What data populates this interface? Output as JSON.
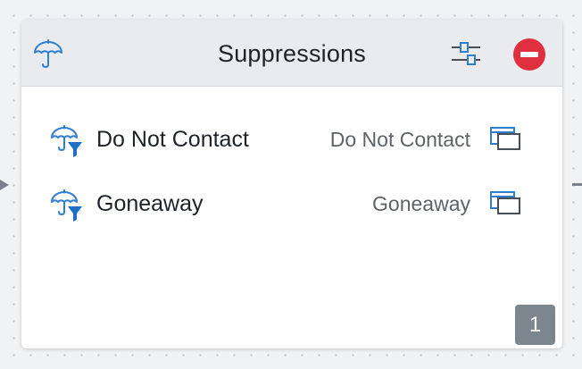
{
  "card": {
    "title": "Suppressions",
    "header_icon": "umbrella-icon",
    "actions": {
      "settings_icon": "sliders-icon",
      "remove_icon": "minus-circle-icon"
    },
    "items": [
      {
        "label": "Do Not Contact",
        "value": "Do Not Contact",
        "icon": "umbrella-filter-icon",
        "action_icon": "windows-icon"
      },
      {
        "label": "Goneaway",
        "value": "Goneaway",
        "icon": "umbrella-filter-icon",
        "action_icon": "windows-icon"
      }
    ],
    "count": "1"
  },
  "colors": {
    "accent_blue": "#2f7fd1",
    "remove_red": "#e0303f",
    "badge_gray": "#7d858f",
    "header_bg": "#e9ebef"
  }
}
